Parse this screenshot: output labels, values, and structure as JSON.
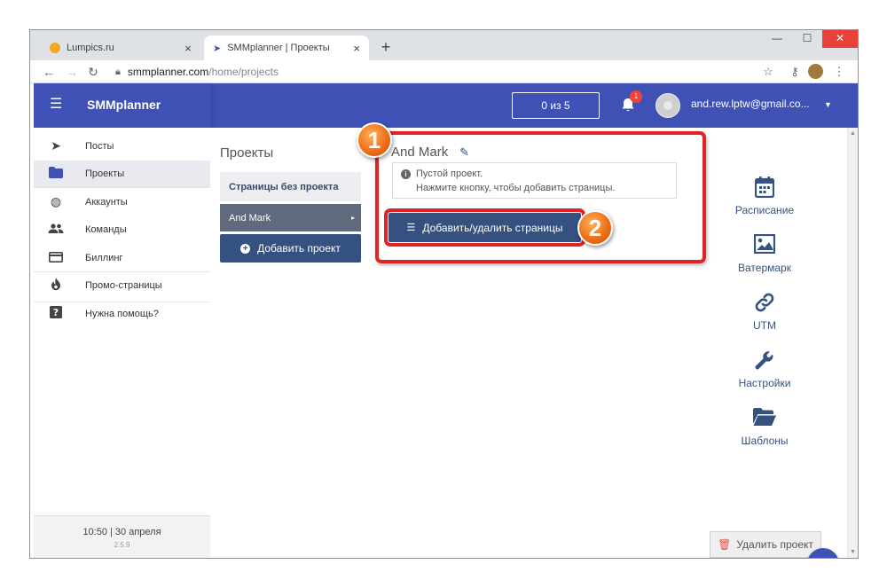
{
  "browser": {
    "tabs": [
      {
        "title": "Lumpics.ru",
        "fav_color": "#f5a623",
        "active": false
      },
      {
        "title": "SMMplanner | Проекты",
        "fav_color": "#3f51b5",
        "active": true
      }
    ],
    "close_glyph": "×",
    "new_tab_glyph": "+",
    "url_host": "smmplanner.com",
    "url_path": "/home/projects",
    "window_controls": {
      "minimize": "—",
      "maximize": "☐",
      "close": "✕"
    }
  },
  "app": {
    "brand": "SMMplanner",
    "counter": "0 из 5",
    "bell_badge": "1",
    "user_email": "and.rew.lptw@gmail.co...",
    "nav": [
      {
        "label": "Посты",
        "icon": "paper-plane-icon",
        "active": false
      },
      {
        "label": "Проекты",
        "icon": "folder-icon",
        "active": true
      },
      {
        "label": "Аккаунты",
        "icon": "accounts-icon",
        "active": false
      },
      {
        "label": "Команды",
        "icon": "team-icon",
        "active": false
      },
      {
        "label": "Биллинг",
        "icon": "credit-card-icon",
        "active": false
      },
      {
        "label": "Промо-страницы",
        "icon": "fire-icon",
        "active": false
      },
      {
        "label": "Нужна помощь?",
        "icon": "help-icon",
        "active": false
      }
    ],
    "footer": {
      "time": "10:50  |  30 апреля",
      "version": "2.5.9"
    }
  },
  "projects": {
    "title": "Проекты",
    "no_project": "Страницы без проекта",
    "items": [
      {
        "label": "And Mark",
        "arrow": "▸"
      }
    ],
    "add_button": "Добавить проект"
  },
  "project": {
    "name": "And Mark",
    "empty_line1": "Пустой проект.",
    "empty_line2": "Нажмите кнопку, чтобы добавить страницы.",
    "add_pages_button": "Добавить/удалить страницы",
    "delete_button": "Удалить проект"
  },
  "tools": [
    {
      "label": "Расписание",
      "icon": "calendar-icon"
    },
    {
      "label": "Ватермарк",
      "icon": "image-icon"
    },
    {
      "label": "UTM",
      "icon": "link-icon"
    },
    {
      "label": "Настройки",
      "icon": "wrench-icon"
    },
    {
      "label": "Шаблоны",
      "icon": "folder-open-icon"
    }
  ],
  "callouts": [
    "1",
    "2"
  ],
  "accent_colors": {
    "header": "#3f51b5",
    "button": "#34517f",
    "highlight": "#e32222",
    "callout": "#f07018"
  }
}
